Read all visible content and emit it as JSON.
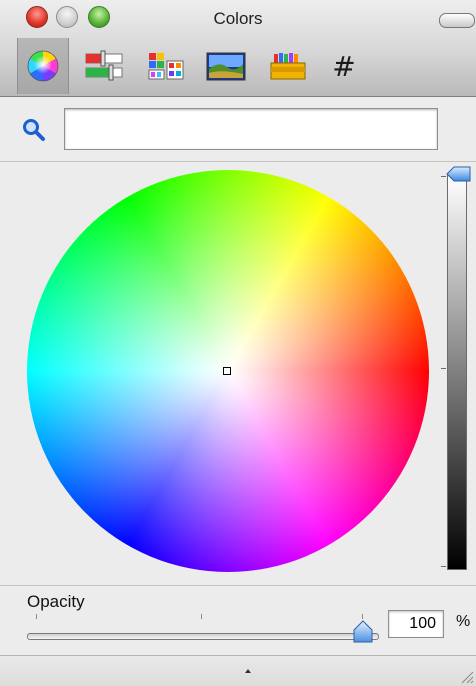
{
  "window": {
    "title": "Colors"
  },
  "toolbar": {
    "tabs": [
      {
        "name": "color-wheel",
        "icon": "color-wheel-icon",
        "selected": true
      },
      {
        "name": "color-sliders",
        "icon": "color-sliders-icon",
        "selected": false
      },
      {
        "name": "color-palettes",
        "icon": "color-palettes-icon",
        "selected": false
      },
      {
        "name": "image-palettes",
        "icon": "image-palettes-icon",
        "selected": false
      },
      {
        "name": "crayons",
        "icon": "crayons-icon",
        "selected": false
      },
      {
        "name": "hex-entry",
        "icon": "hash-icon",
        "label": "#",
        "selected": false
      }
    ]
  },
  "search": {
    "icon": "magnifier-icon",
    "value": ""
  },
  "opacity": {
    "label": "Opacity",
    "value": "100",
    "unit": "%",
    "level": 1.0
  },
  "brightness": {
    "level": 1.0
  },
  "colors": {
    "close": "#e23a2e",
    "minimize": "#cfcfcf",
    "zoom": "#5db73b",
    "selected_color": "#ffffff"
  }
}
